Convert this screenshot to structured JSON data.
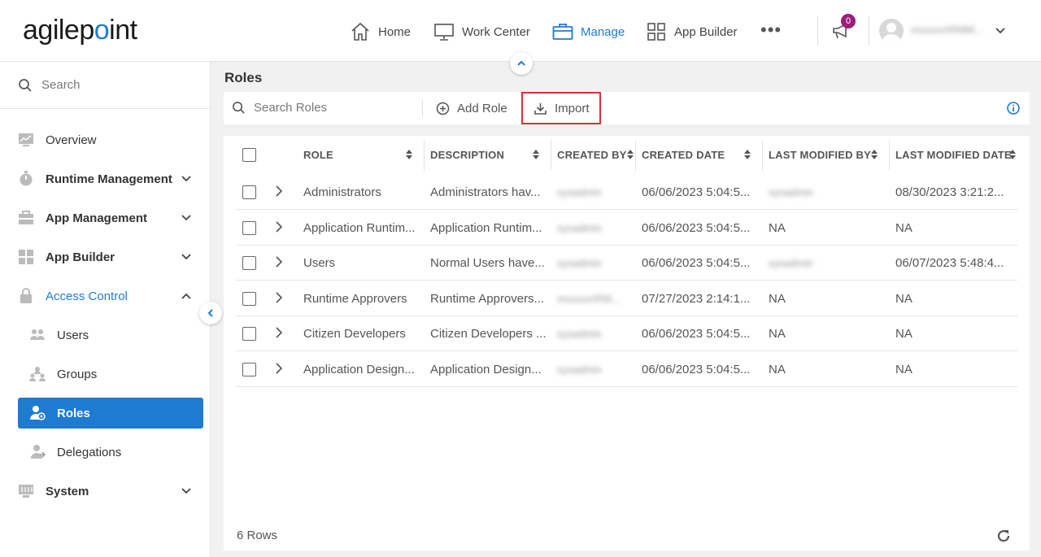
{
  "logo": {
    "pre": "agilep",
    "dot": "o",
    "post": "int"
  },
  "nav": {
    "home": "Home",
    "work_center": "Work Center",
    "manage": "Manage",
    "app_builder": "App Builder",
    "more": "•••",
    "notification_count": "0",
    "username": "mxxxxx\\RMM..."
  },
  "sidebar": {
    "search_placeholder": "Search",
    "items": [
      {
        "label": "Overview",
        "icon": "chart-icon"
      },
      {
        "label": "Runtime Management",
        "icon": "timer-icon"
      },
      {
        "label": "App Management",
        "icon": "briefcase-icon"
      },
      {
        "label": "App Builder",
        "icon": "grid-icon"
      },
      {
        "label": "Access Control",
        "icon": "lock-icon"
      },
      {
        "label": "Users",
        "icon": "users-icon"
      },
      {
        "label": "Groups",
        "icon": "groups-icon"
      },
      {
        "label": "Roles",
        "icon": "roles-icon"
      },
      {
        "label": "Delegations",
        "icon": "delegations-icon"
      },
      {
        "label": "System",
        "icon": "system-icon"
      }
    ]
  },
  "page": {
    "title": "Roles",
    "search_placeholder": "Search Roles",
    "add_role": "Add Role",
    "import": "Import"
  },
  "table": {
    "columns": [
      "ROLE",
      "DESCRIPTION",
      "CREATED BY",
      "CREATED DATE",
      "LAST MODIFIED BY",
      "LAST MODIFIED DATE"
    ],
    "rows": [
      {
        "role": "Administrators",
        "description": "Administrators hav...",
        "created_by": "sysadmin",
        "created_date": "06/06/2023 5:04:5...",
        "modified_by": "sysadmin",
        "modified_date": "08/30/2023 3:21:2..."
      },
      {
        "role": "Application Runtim...",
        "description": "Application Runtim...",
        "created_by": "sysadmin",
        "created_date": "06/06/2023 5:04:5...",
        "modified_by": "NA",
        "modified_date": "NA"
      },
      {
        "role": "Users",
        "description": "Normal Users have...",
        "created_by": "sysadmin",
        "created_date": "06/06/2023 5:04:5...",
        "modified_by": "sysadmin",
        "modified_date": "06/07/2023 5:48:4..."
      },
      {
        "role": "Runtime Approvers",
        "description": "Runtime Approvers...",
        "created_by": "mxxxxx\\RM...",
        "created_date": "07/27/2023 2:14:1...",
        "modified_by": "NA",
        "modified_date": "NA"
      },
      {
        "role": "Citizen Developers",
        "description": "Citizen Developers ...",
        "created_by": "sysadmin",
        "created_date": "06/06/2023 5:04:5...",
        "modified_by": "NA",
        "modified_date": "NA"
      },
      {
        "role": "Application Design...",
        "description": "Application Design...",
        "created_by": "sysadmin",
        "created_date": "06/06/2023 5:04:5...",
        "modified_by": "NA",
        "modified_date": "NA"
      }
    ],
    "row_count": "6 Rows"
  },
  "colors": {
    "accent": "#1f7bd1",
    "highlight_box": "#d13438",
    "badge": "#9c1f7a"
  }
}
